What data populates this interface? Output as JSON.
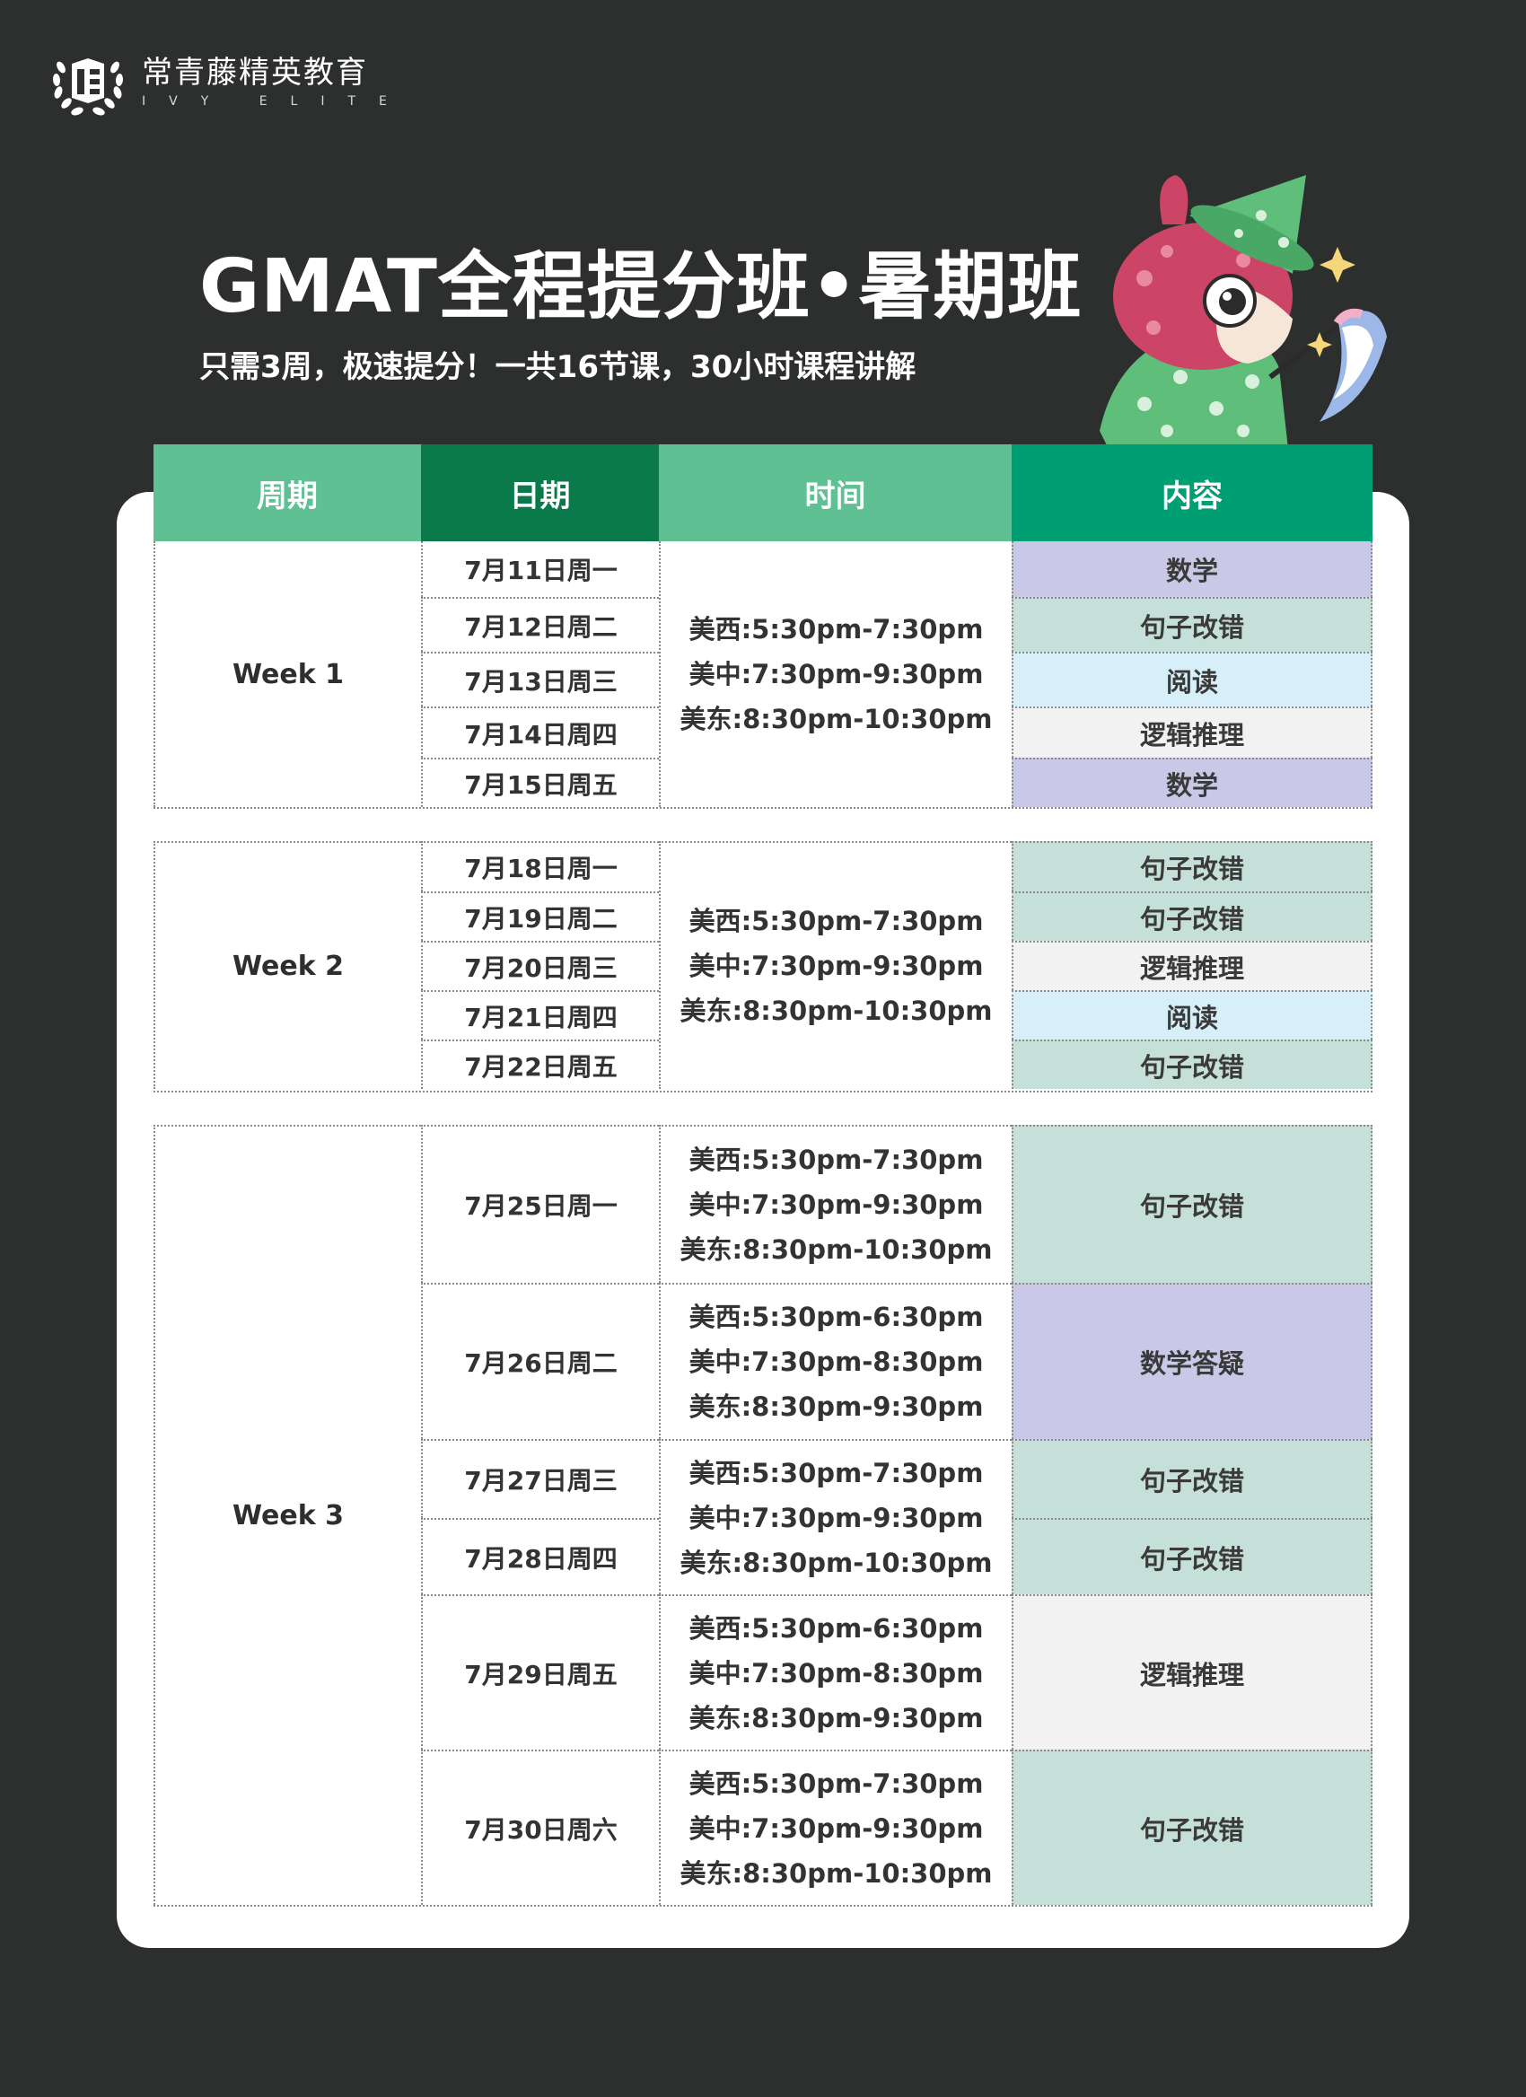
{
  "brand": {
    "name_cn": "常青藤精英教育",
    "name_en": "IVY ELITE"
  },
  "title": "GMAT全程提分班•暑期班",
  "subtitle": "只需3周，极速提分！一共16节课，30小时课程讲解",
  "colors": {
    "background": "#2c2f2e",
    "header_light": "#5ec093",
    "header_dark": "#0a7a4a",
    "header_content": "#009e73",
    "math": "#c9c8e6",
    "sentence": "#c5e0d8",
    "reading": "#d6eff8",
    "logic": "#f1f2f1"
  },
  "table": {
    "headers": [
      "周期",
      "日期",
      "时间",
      "内容"
    ],
    "week1": {
      "label": "Week 1",
      "dates": [
        "7月11日周一",
        "7月12日周二",
        "7月13日周三",
        "7月14日周四",
        "7月15日周五"
      ],
      "times": [
        "美西:5:30pm-7:30pm",
        "美中:7:30pm-9:30pm",
        "美东:8:30pm-10:30pm"
      ],
      "contents": [
        "数学",
        "句子改错",
        "阅读",
        "逻辑推理",
        "数学"
      ]
    },
    "week2": {
      "label": "Week 2",
      "dates": [
        "7月18日周一",
        "7月19日周二",
        "7月20日周三",
        "7月21日周四",
        "7月22日周五"
      ],
      "times": [
        "美西:5:30pm-7:30pm",
        "美中:7:30pm-9:30pm",
        "美东:8:30pm-10:30pm"
      ],
      "contents": [
        "句子改错",
        "句子改错",
        "逻辑推理",
        "阅读",
        "句子改错"
      ]
    },
    "week3": {
      "label": "Week 3",
      "rows": [
        {
          "date": "7月25日周一",
          "times": [
            "美西:5:30pm-7:30pm",
            "美中:7:30pm-9:30pm",
            "美东:8:30pm-10:30pm"
          ],
          "content": "句子改错"
        },
        {
          "date": "7月26日周二",
          "times": [
            "美西:5:30pm-6:30pm",
            "美中:7:30pm-8:30pm",
            "美东:8:30pm-9:30pm"
          ],
          "content": "数学答疑"
        },
        {
          "date": "7月27日周三",
          "content": "句子改错"
        },
        {
          "date": "7月28日周四",
          "content": "句子改错"
        },
        {
          "date": "7月29日周五",
          "times": [
            "美西:5:30pm-6:30pm",
            "美中:7:30pm-8:30pm",
            "美东:8:30pm-9:30pm"
          ],
          "content": "逻辑推理"
        },
        {
          "date": "7月30日周六",
          "times": [
            "美西:5:30pm-7:30pm",
            "美中:7:30pm-9:30pm",
            "美东:8:30pm-10:30pm"
          ],
          "content": "句子改错"
        }
      ],
      "shared_times_27_28": [
        "美西:5:30pm-7:30pm",
        "美中:7:30pm-9:30pm",
        "美东:8:30pm-10:30pm"
      ]
    }
  }
}
